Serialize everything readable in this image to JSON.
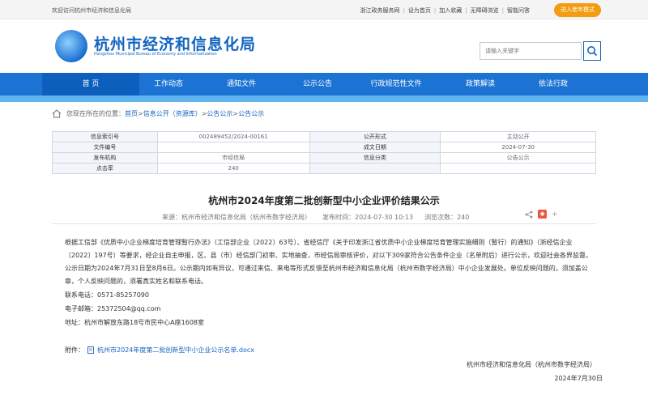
{
  "topbar": {
    "welcome": "欢迎访问杭州市经济和信息化局",
    "links": [
      "浙江政务服务网",
      "设为首页",
      "加入收藏",
      "无障碍浏览",
      "智能问答"
    ],
    "elder_button": "进入老年模式"
  },
  "header": {
    "title": "杭州市经济和信息化局",
    "subtitle": "Hangzhou Municipal Bureau of Economy and Informatization",
    "search_placeholder": "请输入关键字"
  },
  "nav": {
    "items": [
      "首 页",
      "工作动态",
      "通知文件",
      "公示公告",
      "行政规范性文件",
      "政策解读",
      "依法行政"
    ]
  },
  "breadcrumb": {
    "prefix": "您现在所在的位置：",
    "items": [
      "首页",
      "信息公开（资源库）",
      "公告公示",
      "公告公示"
    ],
    "sep": " > "
  },
  "info_table": {
    "rows": [
      {
        "k1": "信息索引号",
        "v1": "002489452/2024-00161",
        "k2": "公开形式",
        "v2": "主动公开"
      },
      {
        "k1": "文件编号",
        "v1": "",
        "k2": "成文日期",
        "v2": "2024-07-30"
      },
      {
        "k1": "发布机构",
        "v1": "市经信局",
        "k2": "信息分类",
        "v2": "公告公示"
      },
      {
        "k1": "点击率",
        "v1": "240",
        "k2": "",
        "v2": ""
      }
    ]
  },
  "article": {
    "title": "杭州市2024年度第二批创新型中小企业评价结果公示",
    "source": "来源：杭州市经济和信息化局（杭州市数字经济局）",
    "publish_time": "发布时间：2024-07-30 10:13",
    "views": "浏览次数：240",
    "body": "根据工信部《优质中小企业梯度培育管理暂行办法》（工信部企业〔2022〕63号）、省经信厅《关于印发浙江省优质中小企业梯度培育管理实施细则（暂行）的通知》（浙经信企业〔2022〕197号）等要求，经企业自主申报，区、县（市）经信部门初审、实地抽查，市经信局审核评价，对以下309家符合公告条件企业（名单附后）进行公示，欢迎社会各界监督。公示日期为2024年7月31日至8月6日。公示期内如有异议，可通过来信、来电等形式反馈至杭州市经济和信息化局（杭州市数字经济局）中小企业发展处。单位反映问题的，须加盖公章，个人反映问题的，须署真实姓名和联系电话。",
    "phone": "联系电话：0571-85257090",
    "email": "电子邮箱：25372504@qq.com",
    "address": "地址：杭州市解放东路18号市民中心A座1608室",
    "attachment_label": "附件：",
    "attachment_name": "杭州市2024年度第二批创新型中小企业公示名单.docx",
    "signature": "杭州市经济和信息化局（杭州市数字经济局）",
    "date": "2024年7月30日"
  },
  "colors": {
    "primary": "#1d73d3",
    "accent": "#f39c12",
    "banner": "#5fb4ef"
  }
}
